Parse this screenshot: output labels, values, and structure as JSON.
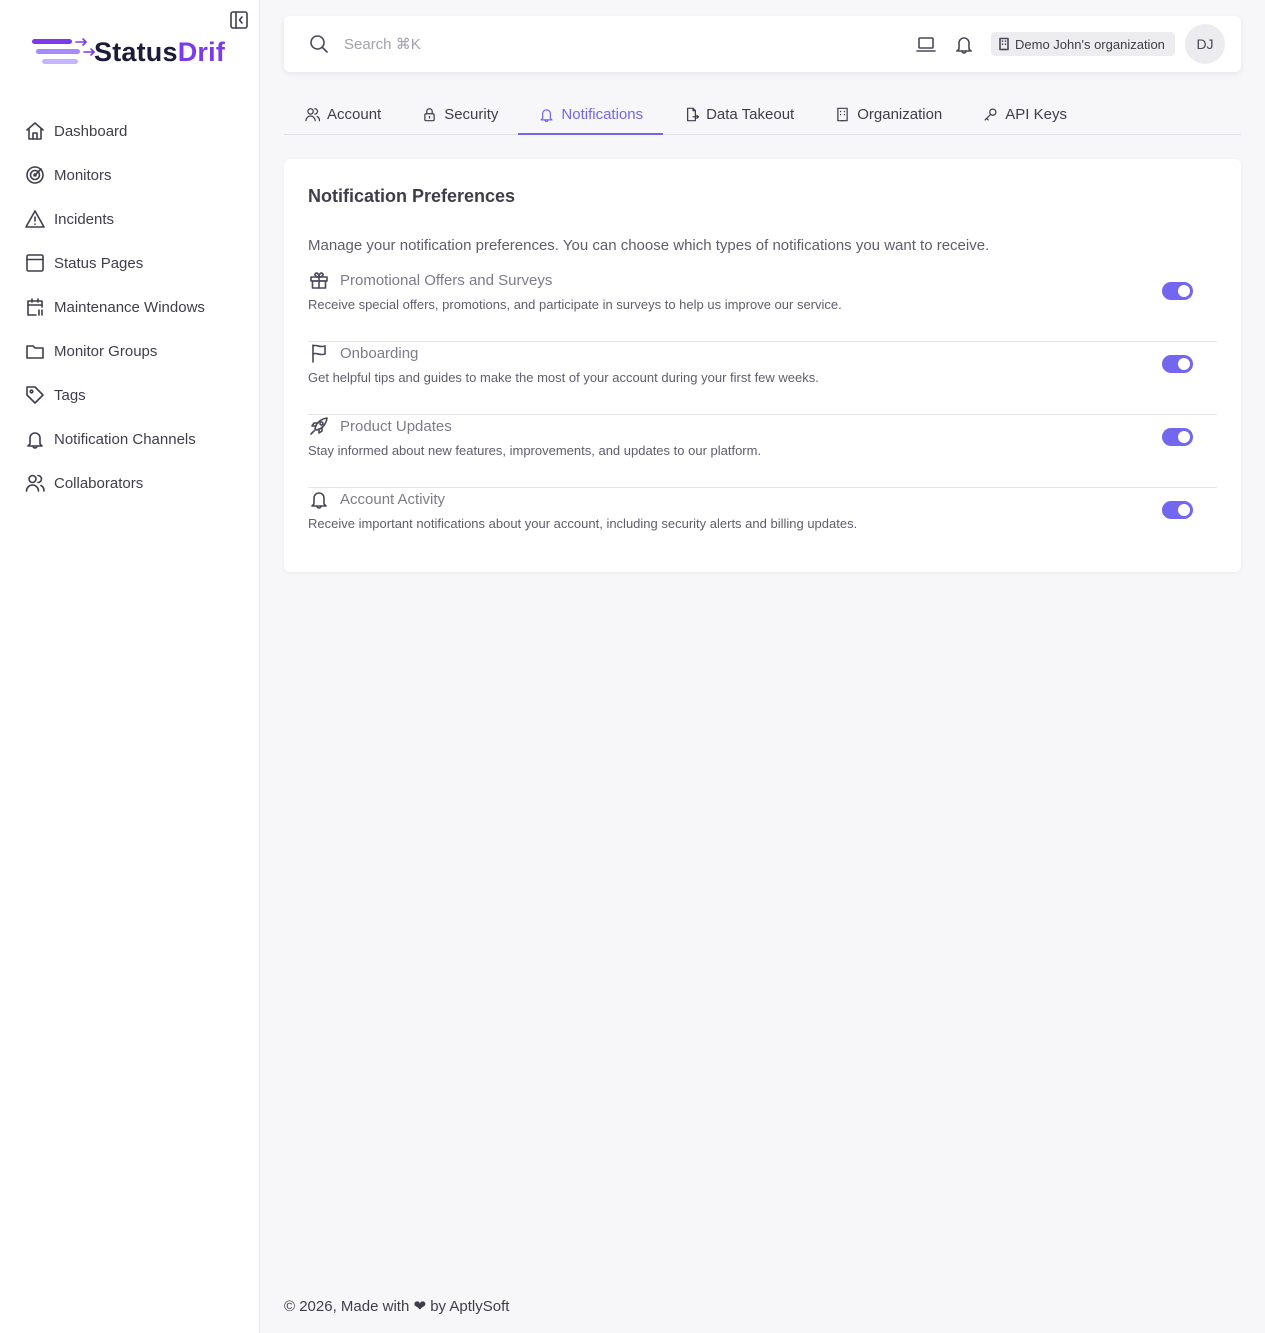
{
  "brand": {
    "name_part1": "Status",
    "name_part2": "Dri",
    "name_part3": "f",
    "accent": "#7367f0",
    "logo_purple": "#7c3aed"
  },
  "sidebar": {
    "items": [
      {
        "label": "Dashboard",
        "icon": "home-icon"
      },
      {
        "label": "Monitors",
        "icon": "radar-icon"
      },
      {
        "label": "Incidents",
        "icon": "alert-triangle-icon"
      },
      {
        "label": "Status Pages",
        "icon": "browser-icon"
      },
      {
        "label": "Maintenance Windows",
        "icon": "calendar-clock-icon"
      },
      {
        "label": "Monitor Groups",
        "icon": "folder-icon"
      },
      {
        "label": "Tags",
        "icon": "tag-icon"
      },
      {
        "label": "Notification Channels",
        "icon": "bell-icon"
      },
      {
        "label": "Collaborators",
        "icon": "users-icon"
      }
    ]
  },
  "header": {
    "search_placeholder": "Search ⌘K",
    "organization": "Demo John's organization",
    "avatar_initials": "DJ"
  },
  "tabs": [
    {
      "label": "Account",
      "icon": "users-icon",
      "active": false
    },
    {
      "label": "Security",
      "icon": "lock-icon",
      "active": false
    },
    {
      "label": "Notifications",
      "icon": "bell-icon",
      "active": true
    },
    {
      "label": "Data Takeout",
      "icon": "file-export-icon",
      "active": false
    },
    {
      "label": "Organization",
      "icon": "building-icon",
      "active": false
    },
    {
      "label": "API Keys",
      "icon": "key-icon",
      "active": false
    }
  ],
  "card": {
    "title": "Notification Preferences",
    "description": "Manage your notification preferences. You can choose which types of notifications you want to receive.",
    "preferences": [
      {
        "title": "Promotional Offers and Surveys",
        "description": "Receive special offers, promotions, and participate in surveys to help us improve our service.",
        "icon": "gift-icon",
        "enabled": true
      },
      {
        "title": "Onboarding",
        "description": "Get helpful tips and guides to make the most of your account during your first few weeks.",
        "icon": "flag-icon",
        "enabled": true
      },
      {
        "title": "Product Updates",
        "description": "Stay informed about new features, improvements, and updates to our platform.",
        "icon": "rocket-icon",
        "enabled": true
      },
      {
        "title": "Account Activity",
        "description": "Receive important notifications about your account, including security alerts and billing updates.",
        "icon": "bell-icon",
        "enabled": true
      }
    ]
  },
  "footer": {
    "text": "© 2026, Made with ❤ by AptlySoft"
  }
}
